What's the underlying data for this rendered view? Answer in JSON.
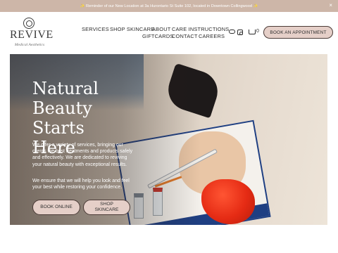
{
  "announcement": {
    "text": "✨ Reminder of our New Location at 3a Hurontario St Suite 102, located in Downtown Collingwood ✨",
    "close_label": "×"
  },
  "brand": {
    "name": "REVIVE",
    "tagline": "Medical Aesthetics"
  },
  "nav": {
    "items": [
      "SERVICES",
      "SHOP SKINCARE",
      "ABOUT",
      "CARE INSTRUCTIONS",
      "GIFTCARDS",
      "CONTACT",
      "CAREERS"
    ],
    "cart_count": "0",
    "book_label": "BOOK AN APPOINTMENT",
    "icons": [
      "link-icon",
      "instagram-icon",
      "cart-icon"
    ]
  },
  "hero": {
    "title_lines": [
      "Natural",
      "Beauty",
      "Starts Here"
    ],
    "paragraph1": "We offer a variety of services, bringing our clients the best treatments and products safely and effectively. We are dedicated to reviving your natural beauty with exceptional results.",
    "paragraph2": "We ensure that we will help you look and feel your best while restoring your confidence.",
    "buttons": [
      "BOOK ONLINE",
      "SHOP SKINCARE"
    ]
  },
  "colors": {
    "announcement_bar": "#cdb6a8",
    "button_fill": "#e5cfc8",
    "button_border": "#4a3a36",
    "text_dark": "#2d2d2d"
  }
}
